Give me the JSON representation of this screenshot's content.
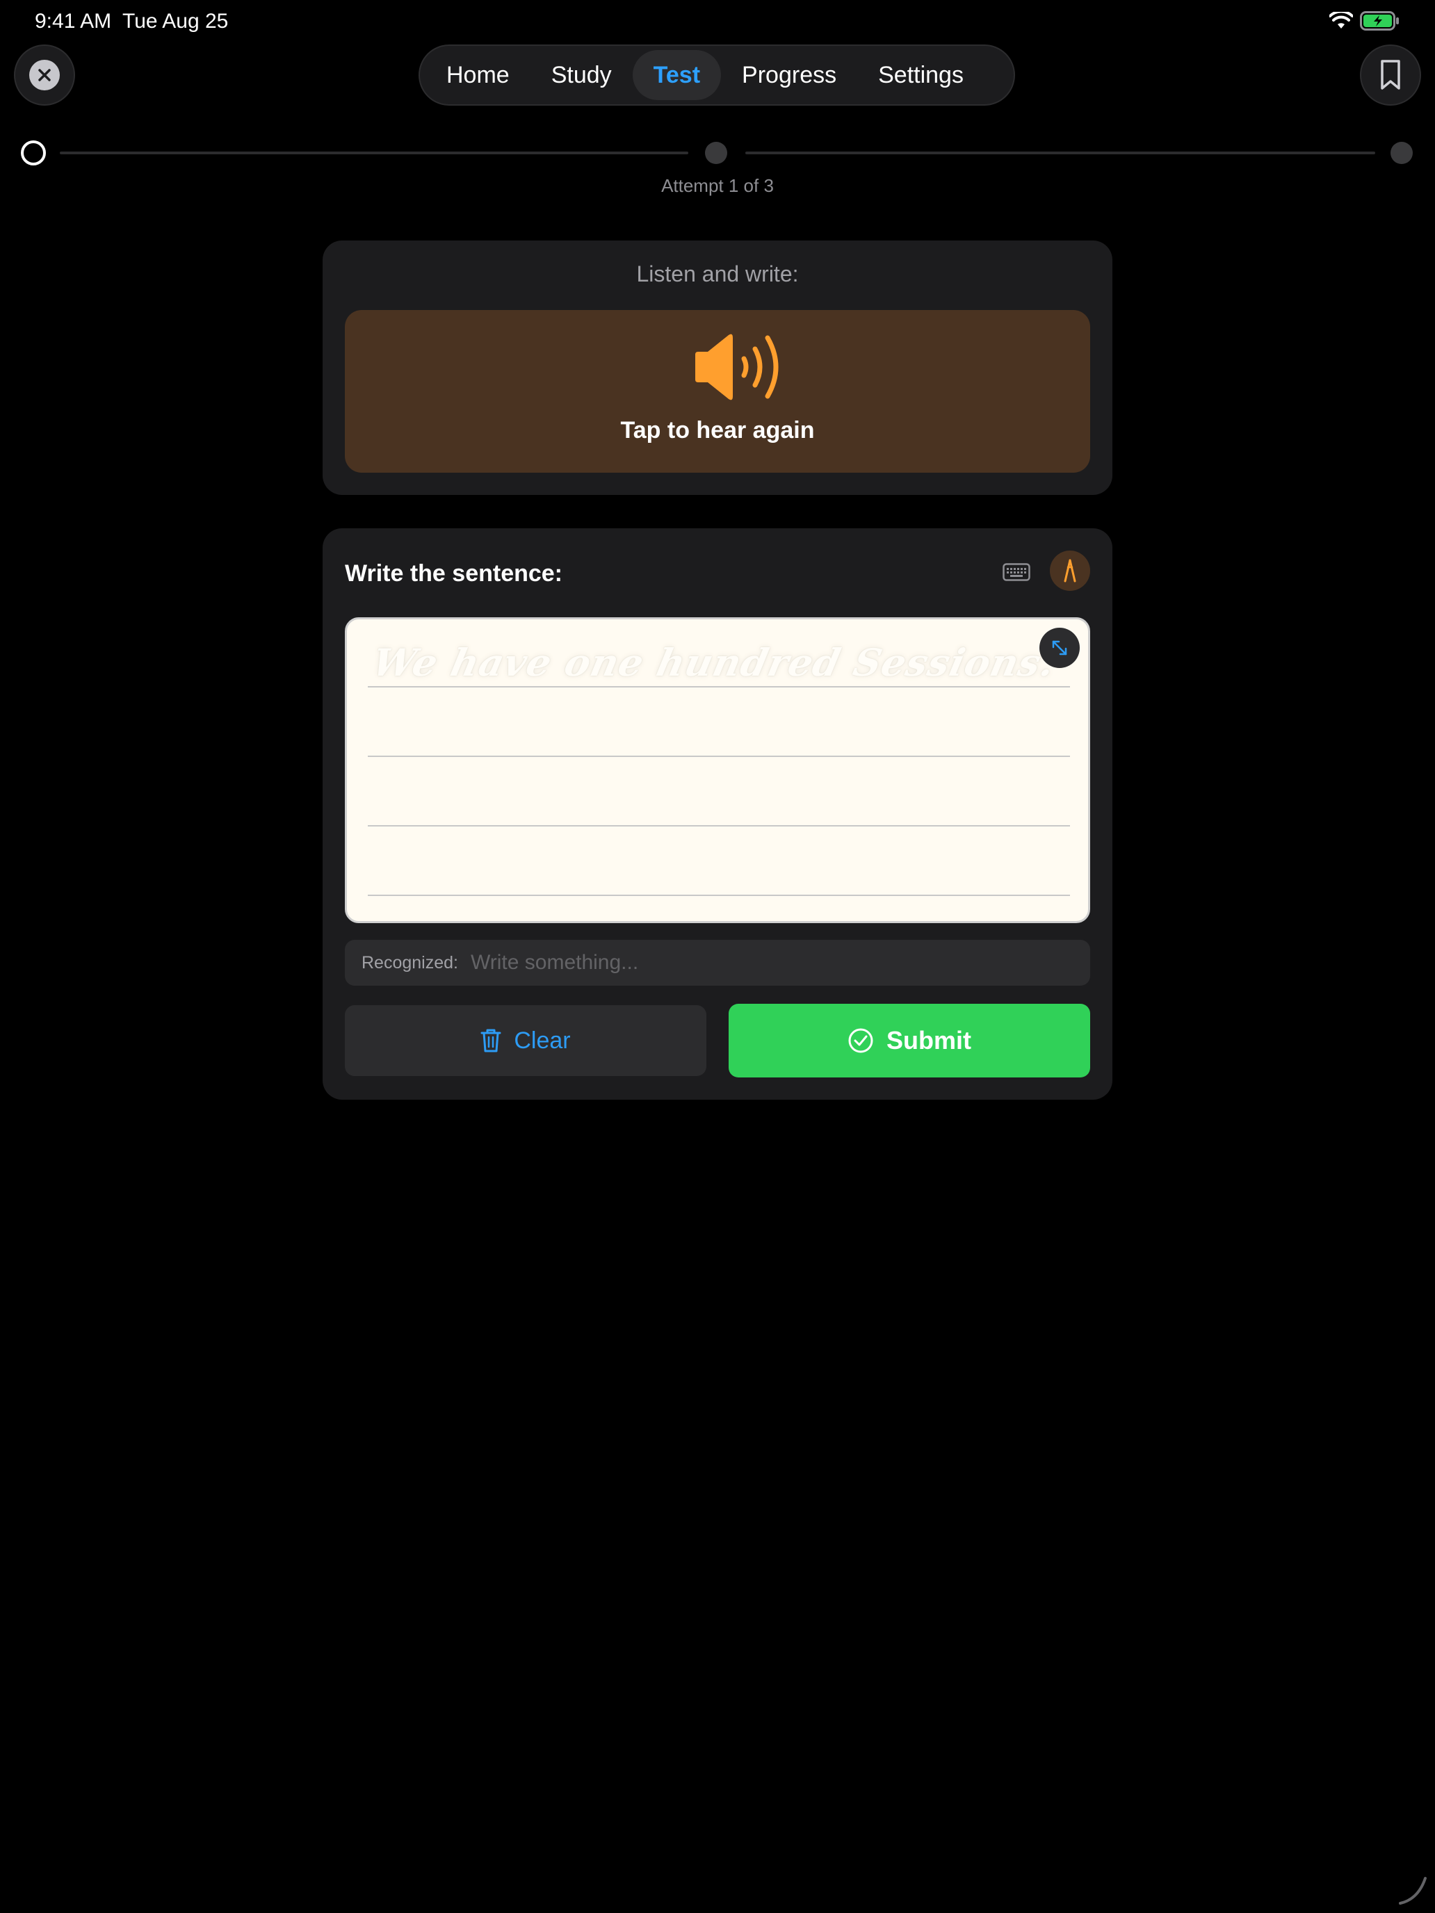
{
  "status_bar": {
    "time": "9:41 AM",
    "date": "Tue Aug 25",
    "battery_color": "#30d158"
  },
  "nav": {
    "close_icon": "close-icon",
    "bookmark_icon": "bookmark-icon",
    "tabs": [
      {
        "label": "Home",
        "active": false
      },
      {
        "label": "Study",
        "active": false
      },
      {
        "label": "Test",
        "active": true
      },
      {
        "label": "Progress",
        "active": false
      },
      {
        "label": "Settings",
        "active": false
      }
    ],
    "active_color": "#2da0ff"
  },
  "progress": {
    "current_step": 1,
    "total_steps": 3,
    "label": "Attempt 1 of 3"
  },
  "listen": {
    "title": "Listen and write:",
    "button_label": "Tap to hear again",
    "icon": "speaker-wave-icon",
    "accent_color": "#ff9f2e"
  },
  "write": {
    "title": "Write the sentence:",
    "keyboard_icon": "keyboard-icon",
    "pen_icon": "pen-icon",
    "expand_icon": "expand-icon",
    "ghost_text": "We have one hundred Sessions.",
    "recognized_label": "Recognized:",
    "recognized_placeholder": "Write something..."
  },
  "actions": {
    "clear_label": "Clear",
    "submit_label": "Submit",
    "clear_color": "#2d9cf5",
    "submit_color": "#30d158"
  }
}
